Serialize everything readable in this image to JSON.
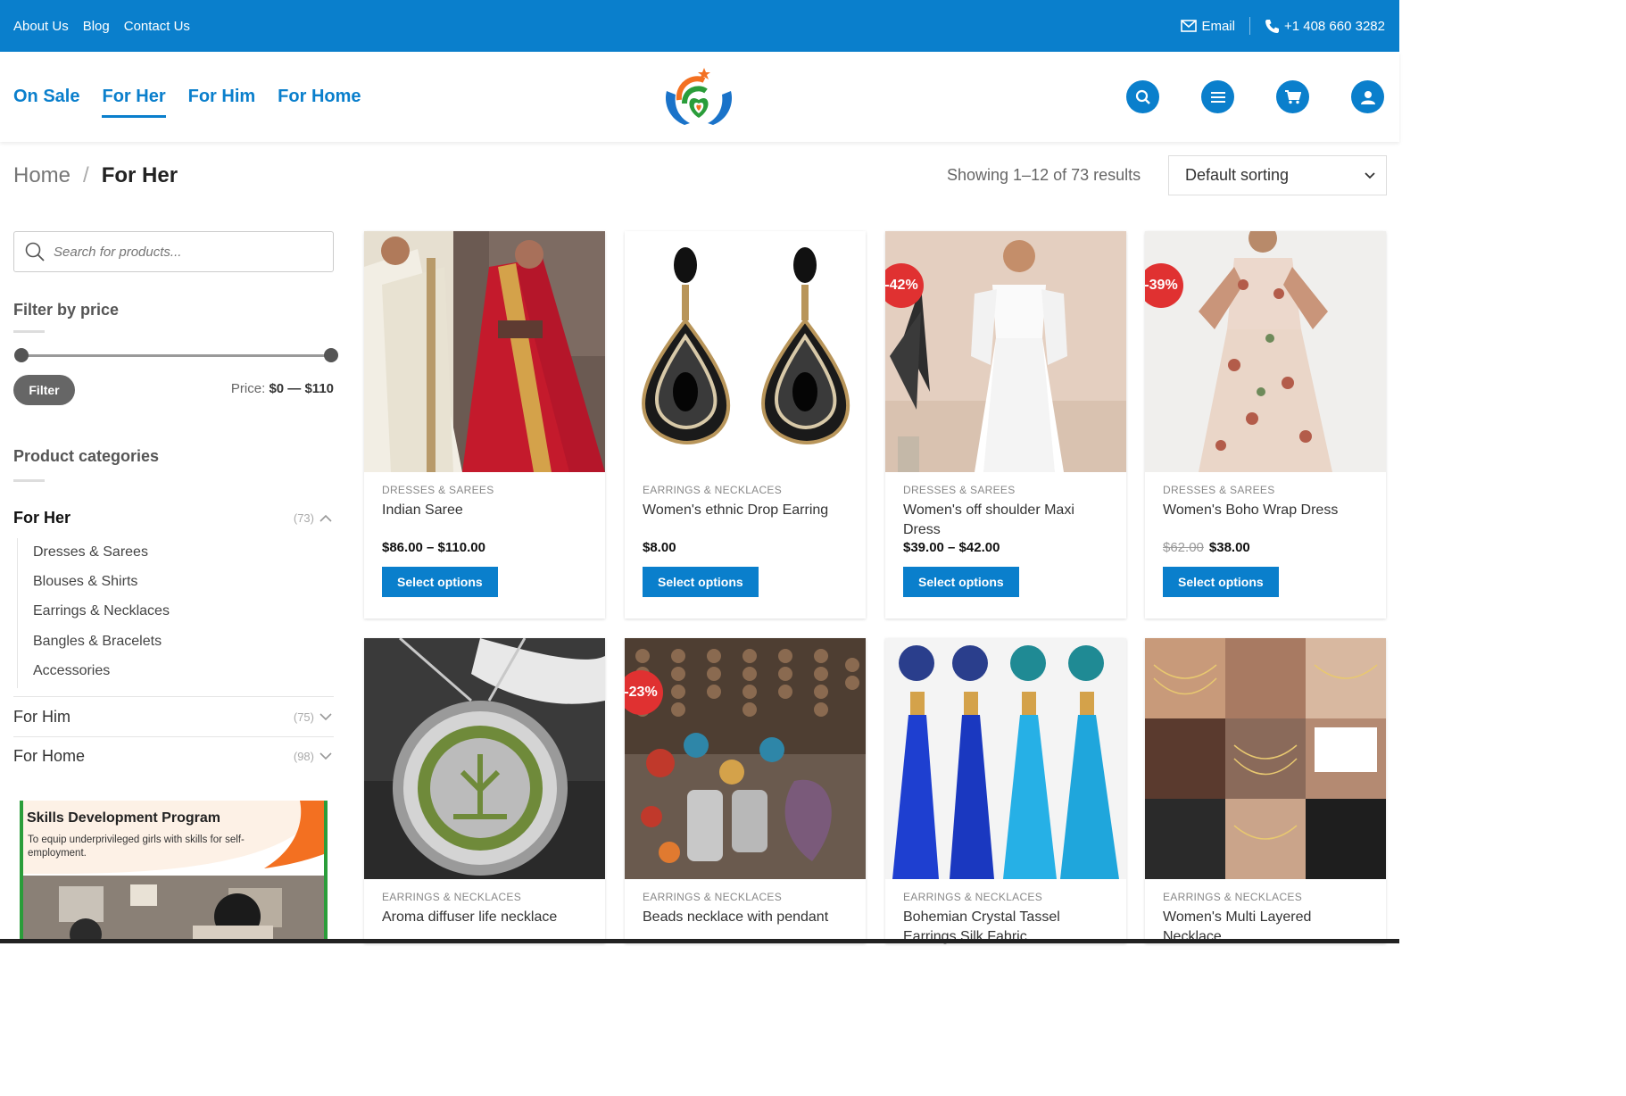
{
  "topbar": {
    "links": [
      "About Us",
      "Blog",
      "Contact Us"
    ],
    "email_label": "Email",
    "phone": "+1 408 660 3282"
  },
  "nav": {
    "items": [
      {
        "label": "On Sale",
        "active": false
      },
      {
        "label": "For Her",
        "active": true
      },
      {
        "label": "For Him",
        "active": false
      },
      {
        "label": "For Home",
        "active": false
      }
    ],
    "icons": [
      "search-icon",
      "menu-icon",
      "cart-icon",
      "account-icon"
    ]
  },
  "breadcrumb": {
    "home": "Home",
    "separator": "/",
    "current": "For Her"
  },
  "results": {
    "text": "Showing 1–12 of 73 results",
    "sort_value": "Default sorting"
  },
  "sidebar": {
    "search_placeholder": "Search for products...",
    "price_filter": {
      "title": "Filter by price",
      "button": "Filter",
      "label": "Price:",
      "range": "$0 — $110",
      "min_fraction": 0,
      "max_fraction": 1
    },
    "categories": {
      "title": "Product categories",
      "main": [
        {
          "label": "For Her",
          "count": "(73)",
          "expanded": true
        },
        {
          "label": "For Him",
          "count": "(75)",
          "expanded": false
        },
        {
          "label": "For Home",
          "count": "(98)",
          "expanded": false
        }
      ],
      "for_her_sub": [
        "Dresses & Sarees",
        "Blouses & Shirts",
        "Earrings & Necklaces",
        "Bangles & Bracelets",
        "Accessories"
      ]
    },
    "banner": {
      "title": "Skills Development Program",
      "text": "To equip underprivileged girls with skills for self- employment."
    }
  },
  "products": [
    {
      "category": "DRESSES & SAREES",
      "title": "Indian Saree",
      "price": "$86.00 – $110.00",
      "button": "Select options"
    },
    {
      "category": "EARRINGS & NECKLACES",
      "title": "Women's ethnic Drop Earring",
      "price": "$8.00",
      "button": "Select options"
    },
    {
      "category": "DRESSES & SAREES",
      "title": "Women's off shoulder Maxi Dress",
      "price": "$39.00 – $42.00",
      "badge": "-42%",
      "button": "Select options"
    },
    {
      "category": "DRESSES & SAREES",
      "title": "Women's Boho Wrap Dress",
      "old_price": "$62.00",
      "price": "$38.00",
      "badge": "-39%",
      "button": "Select options"
    },
    {
      "category": "EARRINGS & NECKLACES",
      "title": "Aroma diffuser life necklace"
    },
    {
      "category": "EARRINGS & NECKLACES",
      "title": "Beads necklace with pendant",
      "badge": "-23%"
    },
    {
      "category": "EARRINGS & NECKLACES",
      "title": "Bohemian Crystal Tassel Earrings Silk Fabric"
    },
    {
      "category": "EARRINGS & NECKLACES",
      "title": "Women's Multi Layered Necklace"
    }
  ],
  "colors": {
    "brand_blue": "#0a7fcc",
    "sale_red": "#e03131"
  }
}
